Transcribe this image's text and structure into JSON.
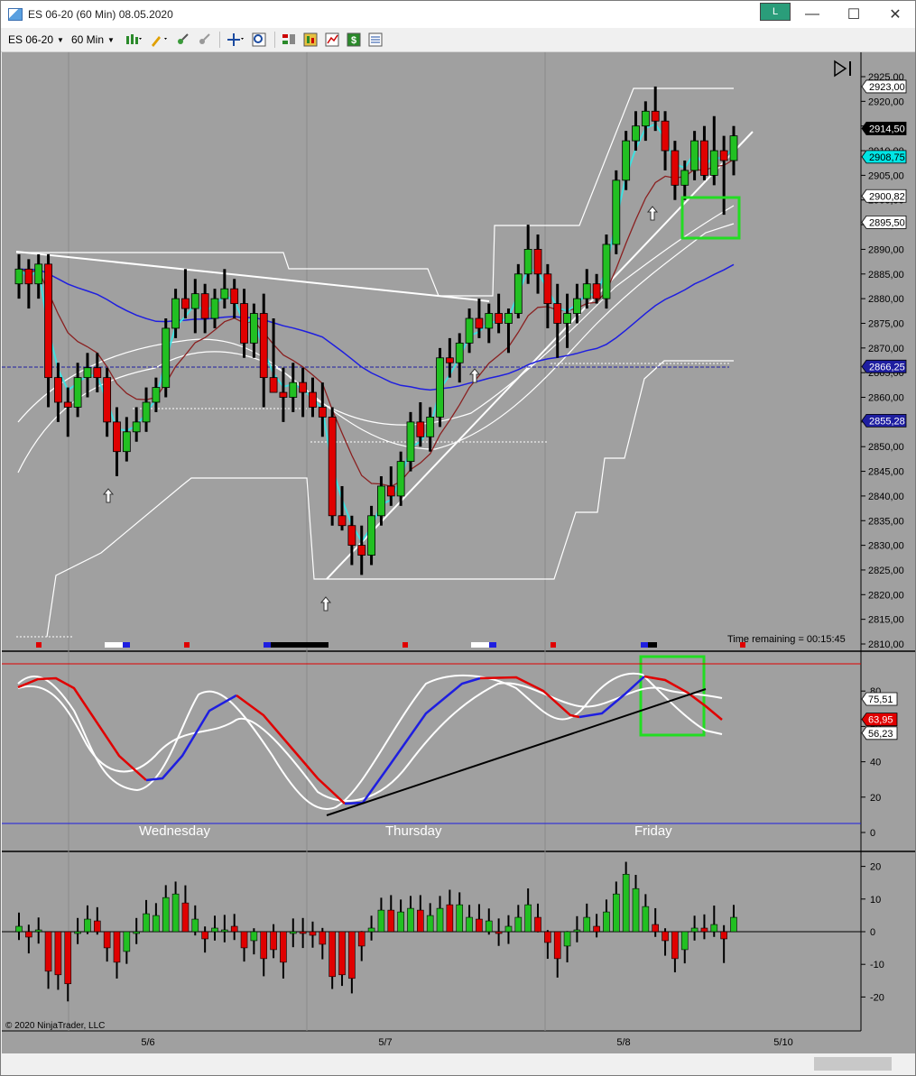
{
  "window": {
    "title": "ES 06-20 (60 Min)  08.05.2020",
    "badge": "L",
    "minimize": "—",
    "maximize": "☐",
    "close": "✕"
  },
  "toolbar": {
    "instrument": "ES 06-20",
    "interval": "60 Min"
  },
  "price_axis": {
    "ticks": [
      "2925,00",
      "2920,00",
      "2915,00",
      "2910,00",
      "2905,00",
      "2900,00",
      "2895,00",
      "2890,00",
      "2885,00",
      "2880,00",
      "2875,00",
      "2870,00",
      "2865,00",
      "2860,00",
      "2855,00",
      "2850,00",
      "2845,00",
      "2840,00",
      "2835,00",
      "2830,00",
      "2825,00",
      "2820,00",
      "2815,00",
      "2810,00"
    ]
  },
  "price_labels": [
    {
      "text": "2923,00",
      "bg": "#ffffff",
      "fg": "#000000"
    },
    {
      "text": "2914,50",
      "bg": "#000000",
      "fg": "#ffffff"
    },
    {
      "text": "2908,75",
      "bg": "#00e5e5",
      "fg": "#000000"
    },
    {
      "text": "2900,82",
      "bg": "#ffffff",
      "fg": "#000000"
    },
    {
      "text": "2895,50",
      "bg": "#ffffff",
      "fg": "#000000"
    },
    {
      "text": "2866,25",
      "bg": "#1e1ea0",
      "fg": "#ffffff"
    },
    {
      "text": "2855,28",
      "bg": "#1e1ea0",
      "fg": "#ffffff"
    }
  ],
  "time_remaining": "Time remaining = 00:15:45",
  "osc_axis": {
    "ticks": [
      "80",
      "60",
      "40",
      "20",
      "0"
    ]
  },
  "osc_labels": [
    {
      "text": "75,51",
      "bg": "#ffffff",
      "fg": "#000000"
    },
    {
      "text": "63,95",
      "bg": "#e00000",
      "fg": "#ffffff"
    },
    {
      "text": "56,23",
      "bg": "#ffffff",
      "fg": "#000000"
    }
  ],
  "days": [
    "Wednesday",
    "Thursday",
    "Friday"
  ],
  "momentum_axis": {
    "ticks": [
      "20",
      "10",
      "0",
      "-10",
      "-20"
    ]
  },
  "copyright": "© 2020 NinjaTrader, LLC",
  "date_axis": [
    "5/6",
    "5/7",
    "5/8",
    "5/10"
  ],
  "colors": {
    "up": "#22c022",
    "down": "#e00000",
    "chart_bg": "#a0a0a0",
    "cyan": "#40e0e0",
    "blue": "#1e1ee0",
    "highlight": "#22dd22"
  },
  "chart_data": {
    "type": "candlestick",
    "ylim": [
      2810,
      2927
    ],
    "candles": [
      {
        "o": 2883,
        "h": 2889,
        "l": 2880,
        "c": 2886
      },
      {
        "o": 2886,
        "h": 2888,
        "l": 2878,
        "c": 2883
      },
      {
        "o": 2883,
        "h": 2889,
        "l": 2880,
        "c": 2887
      },
      {
        "o": 2887,
        "h": 2889,
        "l": 2858,
        "c": 2864
      },
      {
        "o": 2864,
        "h": 2867,
        "l": 2855,
        "c": 2859
      },
      {
        "o": 2859,
        "h": 2862,
        "l": 2852,
        "c": 2858
      },
      {
        "o": 2858,
        "h": 2867,
        "l": 2856,
        "c": 2864
      },
      {
        "o": 2864,
        "h": 2869,
        "l": 2860,
        "c": 2866
      },
      {
        "o": 2866,
        "h": 2869,
        "l": 2861,
        "c": 2864
      },
      {
        "o": 2864,
        "h": 2866,
        "l": 2852,
        "c": 2855
      },
      {
        "o": 2855,
        "h": 2858,
        "l": 2844,
        "c": 2849
      },
      {
        "o": 2849,
        "h": 2856,
        "l": 2847,
        "c": 2853
      },
      {
        "o": 2853,
        "h": 2858,
        "l": 2851,
        "c": 2855
      },
      {
        "o": 2855,
        "h": 2862,
        "l": 2853,
        "c": 2859
      },
      {
        "o": 2859,
        "h": 2864,
        "l": 2857,
        "c": 2862
      },
      {
        "o": 2862,
        "h": 2876,
        "l": 2860,
        "c": 2874
      },
      {
        "o": 2874,
        "h": 2882,
        "l": 2872,
        "c": 2880
      },
      {
        "o": 2880,
        "h": 2886,
        "l": 2876,
        "c": 2878
      },
      {
        "o": 2878,
        "h": 2884,
        "l": 2873,
        "c": 2881
      },
      {
        "o": 2881,
        "h": 2883,
        "l": 2873,
        "c": 2876
      },
      {
        "o": 2876,
        "h": 2882,
        "l": 2874,
        "c": 2880
      },
      {
        "o": 2880,
        "h": 2886,
        "l": 2878,
        "c": 2882
      },
      {
        "o": 2882,
        "h": 2884,
        "l": 2876,
        "c": 2879
      },
      {
        "o": 2879,
        "h": 2882,
        "l": 2868,
        "c": 2871
      },
      {
        "o": 2871,
        "h": 2879,
        "l": 2868,
        "c": 2877
      },
      {
        "o": 2877,
        "h": 2881,
        "l": 2858,
        "c": 2864
      },
      {
        "o": 2864,
        "h": 2876,
        "l": 2862,
        "c": 2861
      },
      {
        "o": 2861,
        "h": 2866,
        "l": 2855,
        "c": 2860
      },
      {
        "o": 2860,
        "h": 2867,
        "l": 2857,
        "c": 2863
      },
      {
        "o": 2863,
        "h": 2866,
        "l": 2856,
        "c": 2861
      },
      {
        "o": 2861,
        "h": 2864,
        "l": 2856,
        "c": 2858
      },
      {
        "o": 2858,
        "h": 2863,
        "l": 2852,
        "c": 2856
      },
      {
        "o": 2856,
        "h": 2858,
        "l": 2834,
        "c": 2836
      },
      {
        "o": 2836,
        "h": 2842,
        "l": 2833,
        "c": 2834
      },
      {
        "o": 2834,
        "h": 2836,
        "l": 2826,
        "c": 2830
      },
      {
        "o": 2830,
        "h": 2834,
        "l": 2824,
        "c": 2828
      },
      {
        "o": 2828,
        "h": 2838,
        "l": 2826,
        "c": 2836
      },
      {
        "o": 2836,
        "h": 2844,
        "l": 2834,
        "c": 2842
      },
      {
        "o": 2842,
        "h": 2846,
        "l": 2838,
        "c": 2840
      },
      {
        "o": 2840,
        "h": 2849,
        "l": 2838,
        "c": 2847
      },
      {
        "o": 2847,
        "h": 2857,
        "l": 2845,
        "c": 2855
      },
      {
        "o": 2855,
        "h": 2859,
        "l": 2850,
        "c": 2852
      },
      {
        "o": 2852,
        "h": 2858,
        "l": 2849,
        "c": 2856
      },
      {
        "o": 2856,
        "h": 2870,
        "l": 2854,
        "c": 2868
      },
      {
        "o": 2868,
        "h": 2872,
        "l": 2864,
        "c": 2867
      },
      {
        "o": 2867,
        "h": 2873,
        "l": 2863,
        "c": 2871
      },
      {
        "o": 2871,
        "h": 2878,
        "l": 2869,
        "c": 2876
      },
      {
        "o": 2876,
        "h": 2880,
        "l": 2872,
        "c": 2874
      },
      {
        "o": 2874,
        "h": 2879,
        "l": 2871,
        "c": 2877
      },
      {
        "o": 2877,
        "h": 2881,
        "l": 2873,
        "c": 2875
      },
      {
        "o": 2875,
        "h": 2878,
        "l": 2869,
        "c": 2877
      },
      {
        "o": 2877,
        "h": 2887,
        "l": 2876,
        "c": 2885
      },
      {
        "o": 2885,
        "h": 2895,
        "l": 2883,
        "c": 2890
      },
      {
        "o": 2890,
        "h": 2893,
        "l": 2881,
        "c": 2885
      },
      {
        "o": 2885,
        "h": 2887,
        "l": 2874,
        "c": 2879
      },
      {
        "o": 2879,
        "h": 2883,
        "l": 2868,
        "c": 2875
      },
      {
        "o": 2875,
        "h": 2881,
        "l": 2870,
        "c": 2877
      },
      {
        "o": 2877,
        "h": 2883,
        "l": 2875,
        "c": 2880
      },
      {
        "o": 2880,
        "h": 2886,
        "l": 2878,
        "c": 2883
      },
      {
        "o": 2883,
        "h": 2885,
        "l": 2879,
        "c": 2880
      },
      {
        "o": 2880,
        "h": 2893,
        "l": 2878,
        "c": 2891
      },
      {
        "o": 2891,
        "h": 2906,
        "l": 2889,
        "c": 2904
      },
      {
        "o": 2904,
        "h": 2914,
        "l": 2902,
        "c": 2912
      },
      {
        "o": 2912,
        "h": 2918,
        "l": 2910,
        "c": 2915
      },
      {
        "o": 2915,
        "h": 2920,
        "l": 2912,
        "c": 2918
      },
      {
        "o": 2918,
        "h": 2923,
        "l": 2914,
        "c": 2916
      },
      {
        "o": 2916,
        "h": 2918,
        "l": 2906,
        "c": 2910
      },
      {
        "o": 2910,
        "h": 2912,
        "l": 2900,
        "c": 2903
      },
      {
        "o": 2903,
        "h": 2908,
        "l": 2900,
        "c": 2906
      },
      {
        "o": 2906,
        "h": 2914,
        "l": 2904,
        "c": 2912
      },
      {
        "o": 2912,
        "h": 2915,
        "l": 2904,
        "c": 2905
      },
      {
        "o": 2905,
        "h": 2917,
        "l": 2903,
        "c": 2910
      },
      {
        "o": 2910,
        "h": 2913,
        "l": 2897,
        "c": 2908
      },
      {
        "o": 2908,
        "h": 2915,
        "l": 2905,
        "c": 2913
      }
    ],
    "osc_ylim": [
      -5,
      97
    ],
    "momentum_ylim": [
      -27,
      22
    ]
  }
}
